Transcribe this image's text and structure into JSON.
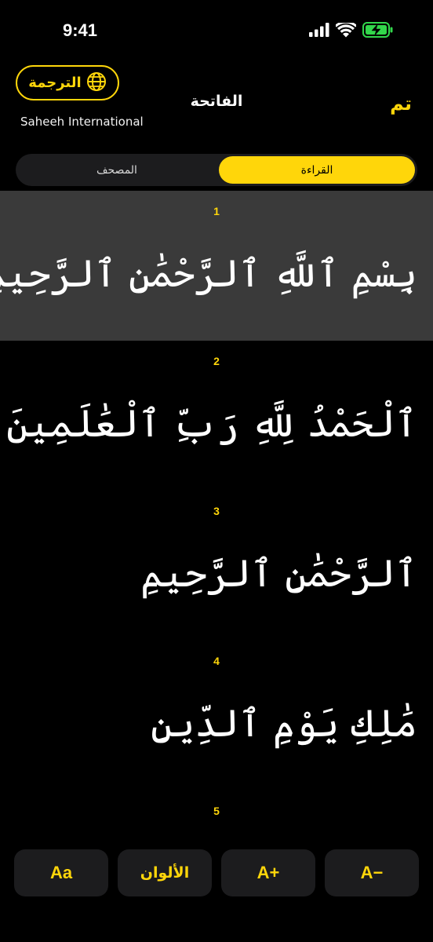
{
  "status_bar": {
    "time": "9:41"
  },
  "header": {
    "translation_button": "الترجمة",
    "translation_name": "Saheeh International",
    "surah_title": "الفاتحة",
    "done_label": "تم"
  },
  "segments": {
    "mushaf": "المصحف",
    "reading": "القراءة",
    "selected": "reading"
  },
  "verses": [
    {
      "number": "1",
      "text": "بِسْمِ ٱللَّهِ ٱلرَّحْمَٰنِ ٱلرَّحِيمِ"
    },
    {
      "number": "2",
      "text": "ٱلْحَمْدُ لِلَّهِ رَبِّ ٱلْعَٰلَمِينَ"
    },
    {
      "number": "3",
      "text": "ٱلرَّحْمَٰنِ ٱلرَّحِيمِ"
    },
    {
      "number": "4",
      "text": "مَٰلِكِ يَوْمِ ٱلدِّينِ"
    },
    {
      "number": "5",
      "text": ""
    }
  ],
  "toolbar": {
    "font_style": "Aa",
    "colors": "الألوان",
    "increase": "A+",
    "decrease": "A−"
  },
  "colors": {
    "accent": "#FFD60A",
    "background": "#000000",
    "highlight": "#3A3A3A",
    "control": "#1C1C1E",
    "battery": "#32D74B"
  },
  "icons": {
    "translation": "globe-icon",
    "signal": "signal-bars-icon",
    "wifi": "wifi-icon",
    "battery": "battery-charging-icon"
  }
}
